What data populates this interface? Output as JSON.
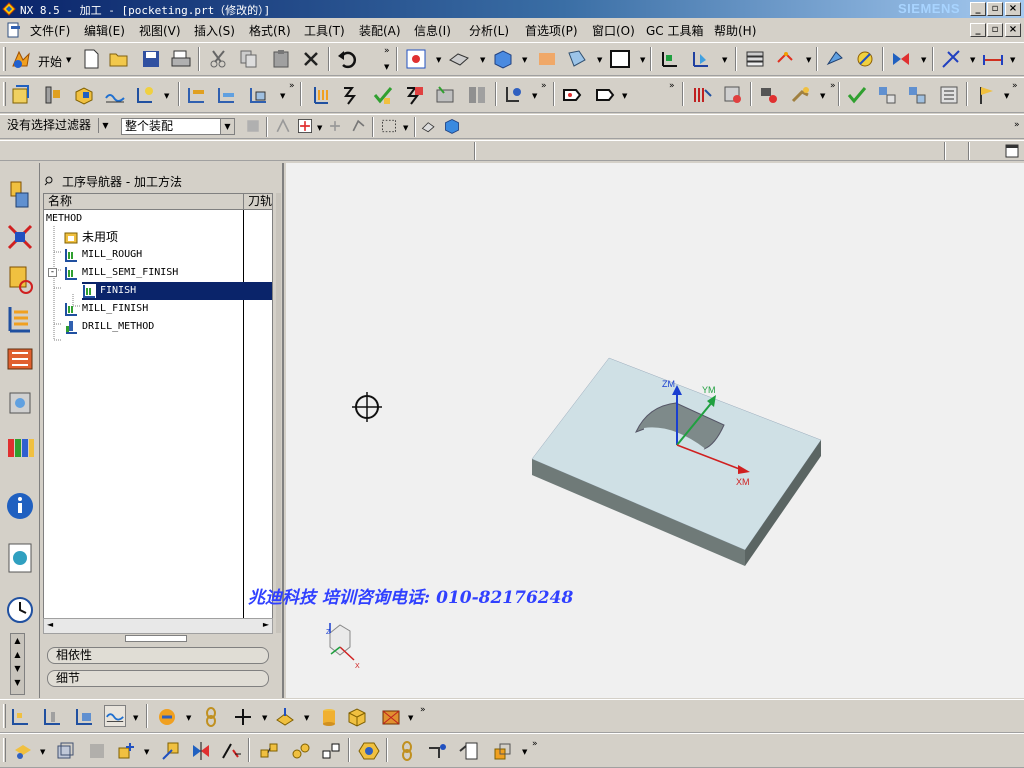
{
  "window": {
    "title": "NX 8.5 - 加工 - [pocketing.prt（修改的）]",
    "brand": "SIEMENS",
    "controls": [
      "_",
      "🗗",
      "×"
    ]
  },
  "menubar": {
    "items": [
      "文件(F)",
      "编辑(E)",
      "视图(V)",
      "插入(S)",
      "格式(R)",
      "工具(T)",
      "装配(A)",
      "信息(I)",
      "分析(L)",
      "首选项(P)",
      "窗口(O)",
      "GC 工具箱",
      "帮助(H)"
    ]
  },
  "toolbar": {
    "start_label": "开始"
  },
  "selection_bar": {
    "filter_value": "没有选择过滤器",
    "scope_value": "整个装配"
  },
  "navigator": {
    "title": "工序导航器 - 加工方法",
    "columns": [
      "名称",
      "刀轨"
    ],
    "tree": [
      {
        "label": "METHOD",
        "level": 0
      },
      {
        "label": "未用项",
        "level": 1
      },
      {
        "label": "MILL_ROUGH",
        "level": 1
      },
      {
        "label": "MILL_SEMI_FINISH",
        "level": 1
      },
      {
        "label": "FINISH",
        "level": 2,
        "selected": true
      },
      {
        "label": "MILL_FINISH",
        "level": 1
      },
      {
        "label": "DRILL_METHOD",
        "level": 1
      }
    ],
    "panels": [
      "相依性",
      "细节"
    ]
  },
  "viewport": {
    "axis_labels": {
      "z": "ZM",
      "y": "YM",
      "x": "XM"
    },
    "triad_labels": {
      "z": "Z",
      "x": "X"
    },
    "watermark": "兆迪科技 培训咨询电话: 010-82176248",
    "colors": {
      "top_face": "#cfe0e5",
      "side_face": "#6f7a78",
      "background": "#f0f0f0"
    }
  }
}
